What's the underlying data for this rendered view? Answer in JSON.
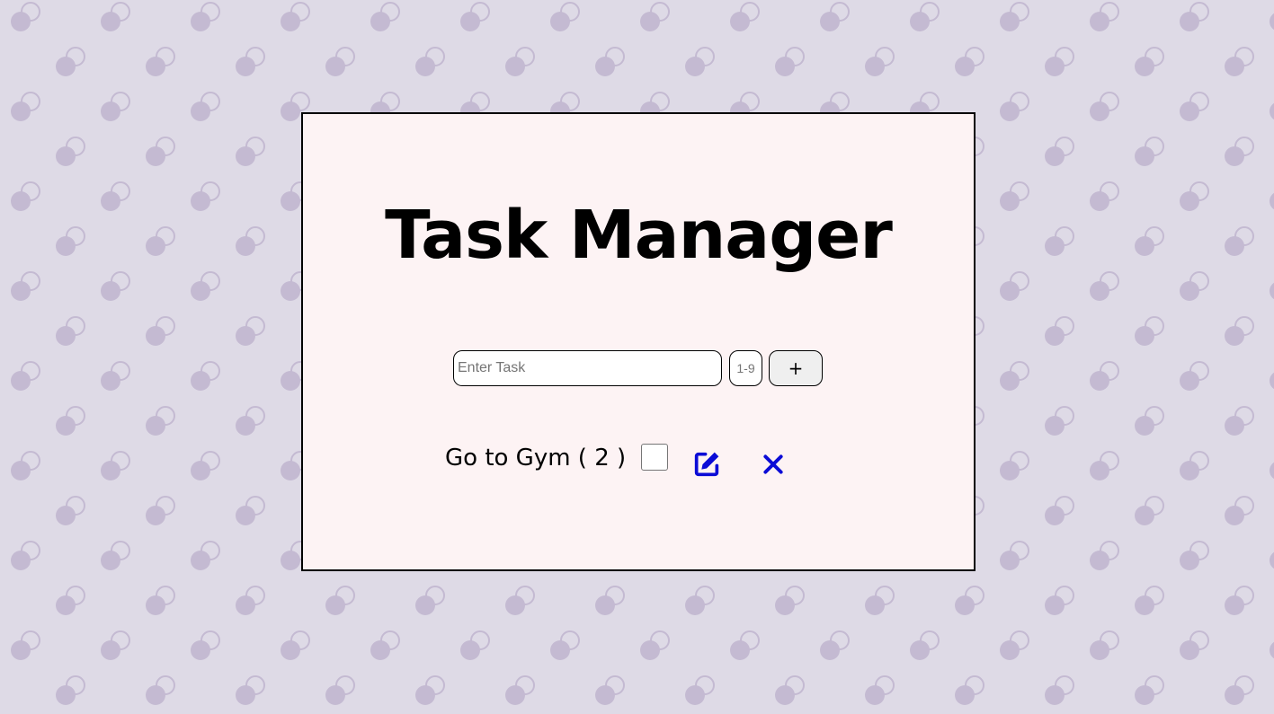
{
  "app": {
    "title": "Task Manager"
  },
  "form": {
    "task_placeholder": "Enter Task",
    "task_value": "",
    "priority_placeholder": "1-9",
    "priority_value": "",
    "add_label": "+"
  },
  "tasks": [
    {
      "label": "Go to Gym ( 2 )",
      "completed": false,
      "edit_icon": "edit-icon",
      "delete_icon": "close-icon"
    }
  ],
  "colors": {
    "background": "#dedae6",
    "pattern": "#c4bad2",
    "card": "#fdf3f4",
    "accent": "#0b0bd6"
  }
}
